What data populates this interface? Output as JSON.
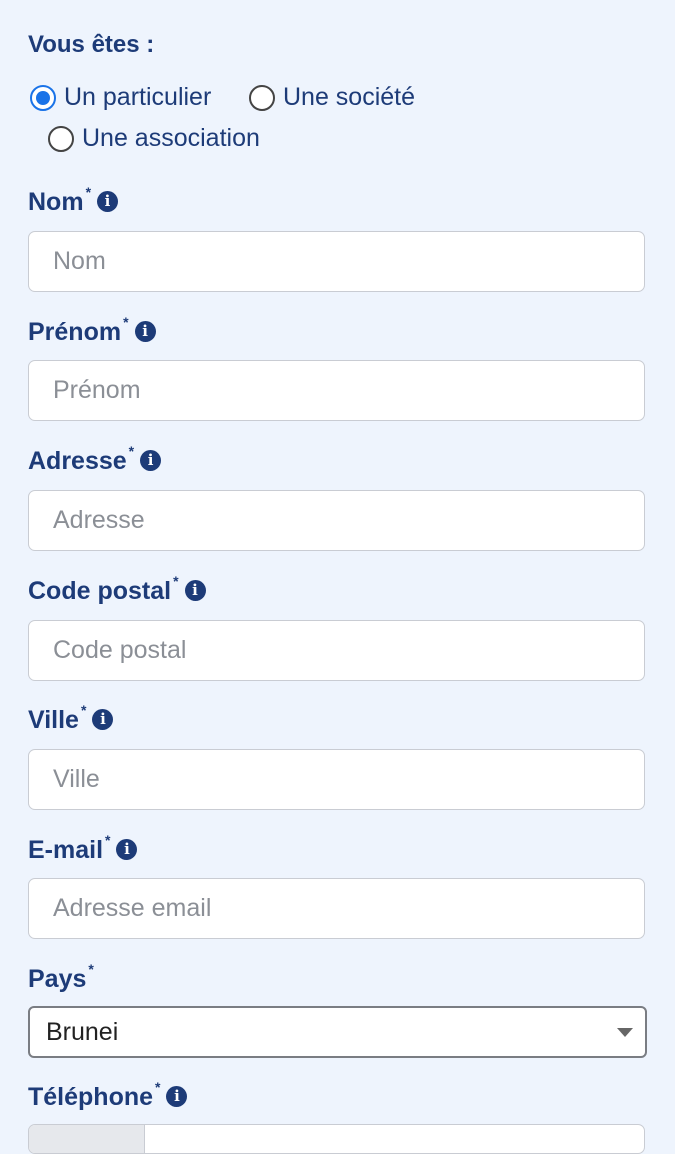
{
  "form": {
    "question": "Vous êtes :",
    "options": [
      "Un particulier",
      "Une société",
      "Une association"
    ],
    "selected_option": "Un particulier",
    "required_mark": "*",
    "info_glyph": "i",
    "fields": {
      "nom": {
        "label": "Nom",
        "placeholder": "Nom",
        "value": ""
      },
      "prenom": {
        "label": "Prénom",
        "placeholder": "Prénom",
        "value": ""
      },
      "adresse": {
        "label": "Adresse",
        "placeholder": "Adresse",
        "value": ""
      },
      "code_postal": {
        "label": "Code postal",
        "placeholder": "Code postal",
        "value": ""
      },
      "ville": {
        "label": "Ville",
        "placeholder": "Ville",
        "value": ""
      },
      "email": {
        "label": "E-mail",
        "placeholder": "Adresse email",
        "value": ""
      }
    },
    "pays": {
      "label": "Pays",
      "value": "Brunei"
    },
    "telephone": {
      "label": "Téléphone"
    }
  },
  "colors": {
    "label": "#1d3b78",
    "accent": "#1a73e8",
    "background": "#eef4fd"
  }
}
